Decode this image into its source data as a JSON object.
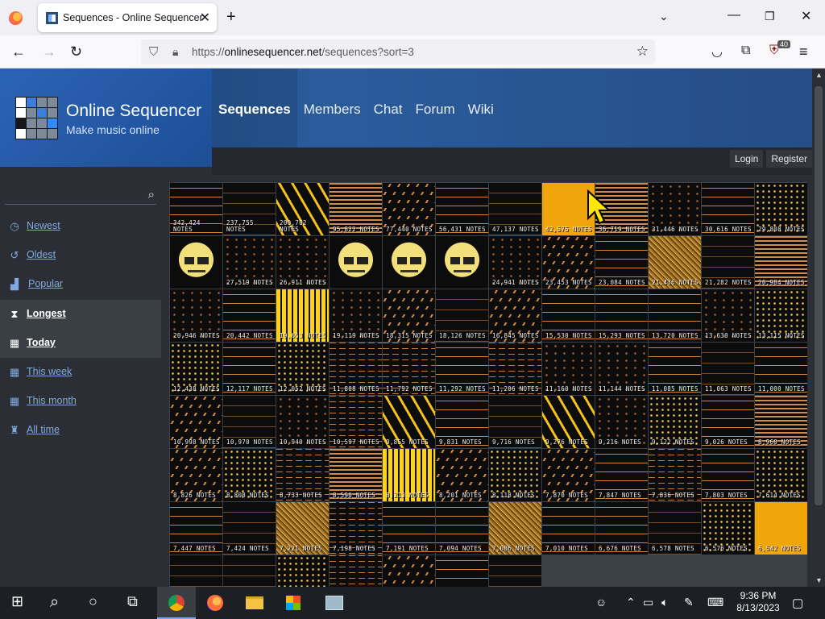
{
  "browser": {
    "tab_title": "Sequences - Online Sequencer",
    "url_prefix": "https://",
    "url_domain": "onlinesequencer.net",
    "url_path": "/sequences?sort=3",
    "extension_badge": "40"
  },
  "site": {
    "title": "Online Sequencer",
    "subtitle": "Make music online",
    "nav": [
      {
        "label": "Sequences",
        "active": true
      },
      {
        "label": "Members"
      },
      {
        "label": "Chat"
      },
      {
        "label": "Forum"
      },
      {
        "label": "Wiki"
      }
    ],
    "login": "Login",
    "register": "Register",
    "search_placeholder": ""
  },
  "sidebar": {
    "items": [
      {
        "label": "Newest",
        "icon": "clock-icon"
      },
      {
        "label": "Oldest",
        "icon": "history-icon"
      },
      {
        "label": "Popular",
        "icon": "chart-icon"
      },
      {
        "label": "Longest",
        "icon": "hourglass-icon",
        "active": true
      },
      {
        "label": "Today",
        "icon": "calendar-icon",
        "active": true
      },
      {
        "label": "This week",
        "icon": "calendar-icon"
      },
      {
        "label": "This month",
        "icon": "calendar-icon"
      },
      {
        "label": "All time",
        "icon": "trophy-icon"
      }
    ]
  },
  "tiles": [
    "342,424 NOTES",
    "237,755 NOTES",
    "200,702 NOTES",
    "95,822 NOTES",
    "77,440 NOTES",
    "56,431 NOTES",
    "47,137 NOTES",
    "42,575 NOTES",
    "36,719 NOTES",
    "31,446 NOTES",
    "30,616 NOTES",
    "29,808 NOTES",
    "",
    "27,519 NOTES",
    "26,911 NOTES",
    "",
    "",
    "",
    "24,941 NOTES",
    "23,453 NOTES",
    "23,084 NOTES",
    "21,436 NOTES",
    "21,282 NOTES",
    "20,984 NOTES",
    "20,946 NOTES",
    "20,442 NOTES",
    "19,653 NOTES",
    "19,119 NOTES",
    "18,315 NOTES",
    "18,126 NOTES",
    "16,845 NOTES",
    "15,530 NOTES",
    "15,293 NOTES",
    "13,720 NOTES",
    "13,630 NOTES",
    "13,115 NOTES",
    "12,438 NOTES",
    "12,117 NOTES",
    "12,052 NOTES",
    "11,808 NOTES",
    "11,792 NOTES",
    "11,292 NOTES",
    "11,206 NOTES",
    "11,160 NOTES",
    "11,144 NOTES",
    "11,085 NOTES",
    "11,063 NOTES",
    "11,000 NOTES",
    "10,998 NOTES",
    "10,970 NOTES",
    "10,940 NOTES",
    "10,597 NOTES",
    "9,855 NOTES",
    "9,831 NOTES",
    "9,716 NOTES",
    "9,276 NOTES",
    "9,216 NOTES",
    "9,122 NOTES",
    "9,026 NOTES",
    "8,960 NOTES",
    "8,826 NOTES",
    "8,808 NOTES",
    "8,733 NOTES",
    "8,590 NOTES",
    "8,213 NOTES",
    "8,201 NOTES",
    "8,118 NOTES",
    "7,870 NOTES",
    "7,847 NOTES",
    "7,836 NOTES",
    "7,803 NOTES",
    "7,614 NOTES",
    "7,447 NOTES",
    "7,424 NOTES",
    "7,221 NOTES",
    "7,198 NOTES",
    "7,191 NOTES",
    "7,094 NOTES",
    "7,086 NOTES",
    "7,010 NOTES",
    "6,676 NOTES",
    "6,578 NOTES",
    "6,576 NOTES",
    "6,542 NOTES",
    "",
    "",
    "",
    "",
    "",
    "",
    ""
  ],
  "tile_patterns": [
    "p-lines",
    "p-dim",
    "p-zig",
    "p-orange-lines",
    "p-diag",
    "p-lines",
    "p-dim",
    "p-yellow",
    "p-orange-lines",
    "p-sparse",
    "p-lines",
    "p-dots",
    "p-face",
    "p-sparse",
    "p-sparse",
    "p-face",
    "p-face",
    "p-face",
    "p-sparse",
    "p-diag",
    "p-lines",
    "p-noise",
    "p-dim",
    "p-orange-lines",
    "p-sparse",
    "p-lines",
    "p-yellowbars",
    "p-sparse",
    "p-diag",
    "p-dim",
    "p-diag",
    "p-lines",
    "p-lines",
    "p-lines",
    "p-sparse",
    "p-dots",
    "p-dots",
    "p-lines",
    "p-dots",
    "p-dash",
    "p-dash",
    "p-lines",
    "p-dash",
    "p-sparse",
    "p-sparse",
    "p-lines",
    "p-dim",
    "p-lines",
    "p-diag",
    "p-dim",
    "p-sparse",
    "p-dash",
    "p-zig",
    "p-lines",
    "p-dim",
    "p-zig",
    "p-sparse",
    "p-dots",
    "p-lines",
    "p-orange-lines",
    "p-diag",
    "p-dots",
    "p-dash",
    "p-orange-lines",
    "p-yellowbars",
    "p-diag",
    "p-dots",
    "p-diag",
    "p-lines",
    "p-dash",
    "p-lines",
    "p-dots",
    "p-lines",
    "p-dim",
    "p-noise",
    "p-dash",
    "p-lines",
    "p-lines",
    "p-noise",
    "p-lines",
    "p-lines",
    "p-dim",
    "p-dots",
    "p-yellow",
    "p-dim",
    "p-dim",
    "p-dots",
    "p-dash",
    "p-diag",
    "p-lines",
    "p-dim"
  ],
  "taskbar": {
    "time": "9:36 PM",
    "date": "8/13/2023"
  }
}
